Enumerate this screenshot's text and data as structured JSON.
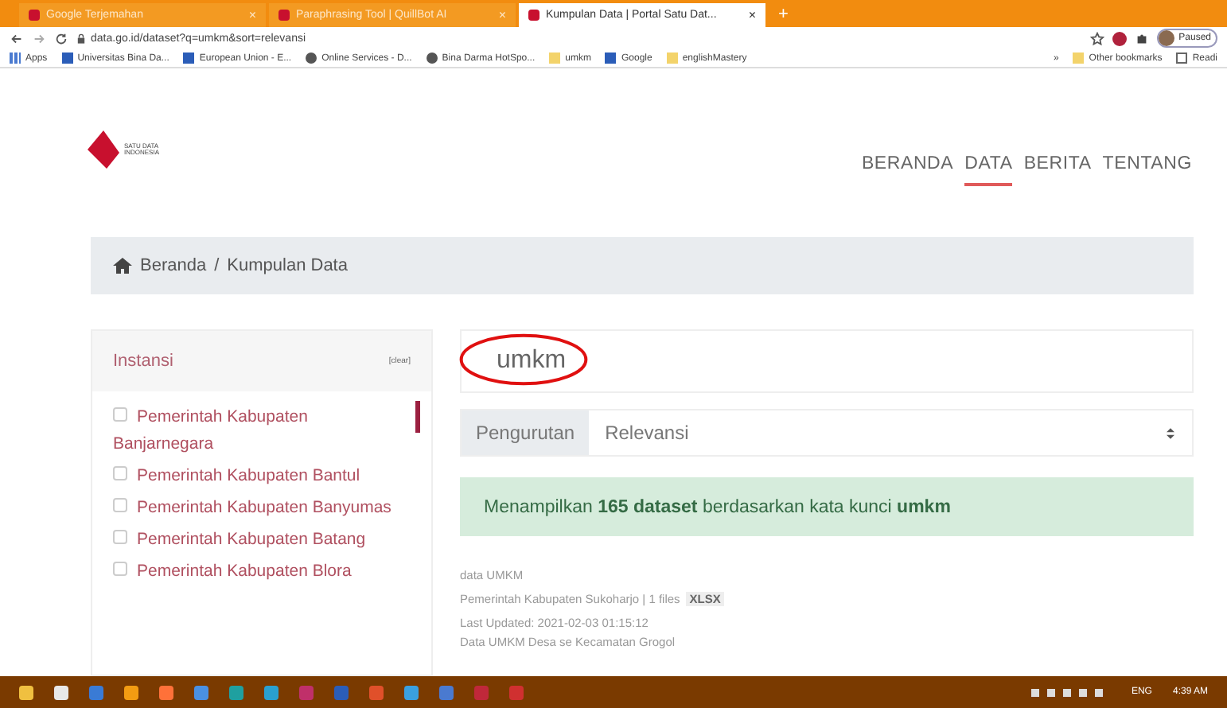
{
  "browser": {
    "tabs": [
      {
        "title": "Google Terjemahan",
        "close": "×",
        "selected": false
      },
      {
        "title": "Paraphrasing Tool | QuillBot AI",
        "close": "×",
        "selected": false
      },
      {
        "title": "Kumpulan Data | Portal Satu Dat...",
        "close": "×",
        "selected": true
      }
    ],
    "new_tab": "+",
    "address": "data.go.id/dataset?q=umkm&sort=relevansi",
    "profile": "Paused",
    "bookmarks": [
      {
        "label": "Apps",
        "kind": "apps"
      },
      {
        "label": "Universitas Bina Da...",
        "kind": "site"
      },
      {
        "label": "European Union - E...",
        "kind": "site"
      },
      {
        "label": "Online Services - D...",
        "kind": "globe"
      },
      {
        "label": "Bina Darma HotSpo...",
        "kind": "globe"
      },
      {
        "label": "umkm",
        "kind": "folder"
      },
      {
        "label": "Google",
        "kind": "site"
      },
      {
        "label": "englishMastery",
        "kind": "folder"
      }
    ],
    "more": "»",
    "other_bookmarks": "Other bookmarks",
    "reading_list": "Readi"
  },
  "site": {
    "logo_text": "SATU DATA INDONESIA",
    "nav": [
      {
        "label": "BERANDA",
        "selected": false
      },
      {
        "label": "DATA",
        "selected": true
      },
      {
        "label": "BERITA",
        "selected": false
      },
      {
        "label": "TENTANG",
        "selected": false
      }
    ],
    "breadcrumb": [
      "Beranda",
      "/",
      "Kumpulan Data"
    ],
    "sidebar": {
      "title": "Instansi",
      "clear": "[clear]",
      "items": [
        {
          "label": "Pemerintah Kabupaten Banjarnegara",
          "checked": false
        },
        {
          "label": "Pemerintah Kabupaten Bantul",
          "checked": false
        },
        {
          "label": "Pemerintah Kabupaten Banyumas",
          "checked": false
        },
        {
          "label": "Pemerintah Kabupaten Batang",
          "checked": false
        },
        {
          "label": "Pemerintah Kabupaten Blora",
          "checked": false
        }
      ]
    },
    "search": {
      "value": "umkm"
    },
    "sort": {
      "label": "Pengurutan",
      "value": "Relevansi"
    },
    "alert": "Menampilkan **165 dataset** berdasarkan kata kunci **umkm**",
    "results": [
      {
        "title": "data UMKM",
        "source": "Pemerintah Kabupaten Sukoharjo | 1 files",
        "format": "XLSX",
        "updated": "Last Updated: 2021-02-03 01:15:12"
      },
      {
        "title": "Data UMKM Desa se Kecamatan Grogol"
      }
    ]
  },
  "taskbar": {
    "language": "ENG",
    "time": "4:39 AM"
  }
}
